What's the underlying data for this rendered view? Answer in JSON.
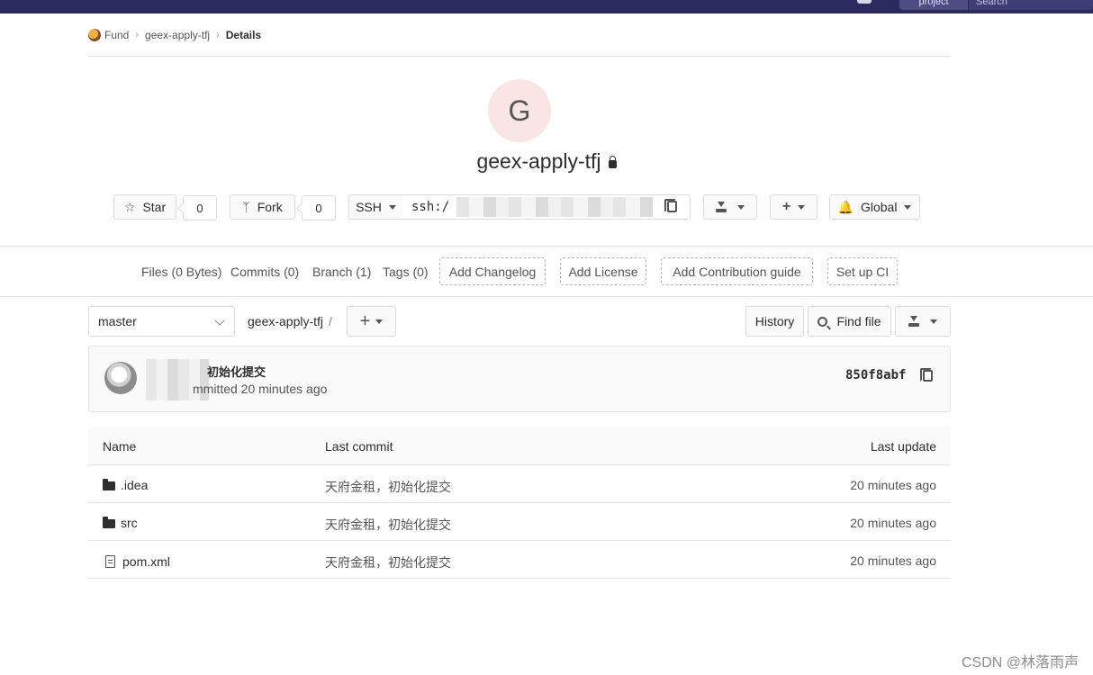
{
  "topbar": {
    "project_btn": "project",
    "search_placeholder": "Search"
  },
  "breadcrumb": {
    "group": "Fund",
    "project": "geex-apply-tfj",
    "current": "Details"
  },
  "project": {
    "avatar_letter": "G",
    "name": "geex-apply-tfj"
  },
  "actions": {
    "star_label": "Star",
    "star_count": "0",
    "fork_label": "Fork",
    "fork_count": "0",
    "clone_protocol": "SSH",
    "clone_url": "ssh:/",
    "notification_label": "Global"
  },
  "stats": {
    "files": "Files (0 Bytes)",
    "commits": "Commits (0)",
    "branch": "Branch (1)",
    "tags": "Tags (0)",
    "add_changelog": "Add Changelog",
    "add_license": "Add License",
    "add_contribution": "Add Contribution guide",
    "setup_ci": "Set up CI"
  },
  "toolbar": {
    "branch": "master",
    "path": "geex-apply-tfj",
    "path_sep": "/",
    "history": "History",
    "find_file": "Find file"
  },
  "last_commit": {
    "title": "初始化提交",
    "meta": "mmitted 20 minutes ago",
    "sha": "850f8abf"
  },
  "tree": {
    "headers": {
      "name": "Name",
      "last_commit": "Last commit",
      "last_update": "Last update"
    },
    "rows": [
      {
        "name": ".idea",
        "type": "folder",
        "commit": "天府金租，初始化提交",
        "updated": "20 minutes ago"
      },
      {
        "name": "src",
        "type": "folder",
        "commit": "天府金租，初始化提交",
        "updated": "20 minutes ago"
      },
      {
        "name": "pom.xml",
        "type": "file",
        "commit": "天府金租，初始化提交",
        "updated": "20 minutes ago"
      }
    ]
  },
  "watermark": "CSDN @林落雨声",
  "colors": {
    "topbar": "#2b2a5e",
    "avatar_bg": "#f9e5e3",
    "border": "#dcdcdc"
  }
}
